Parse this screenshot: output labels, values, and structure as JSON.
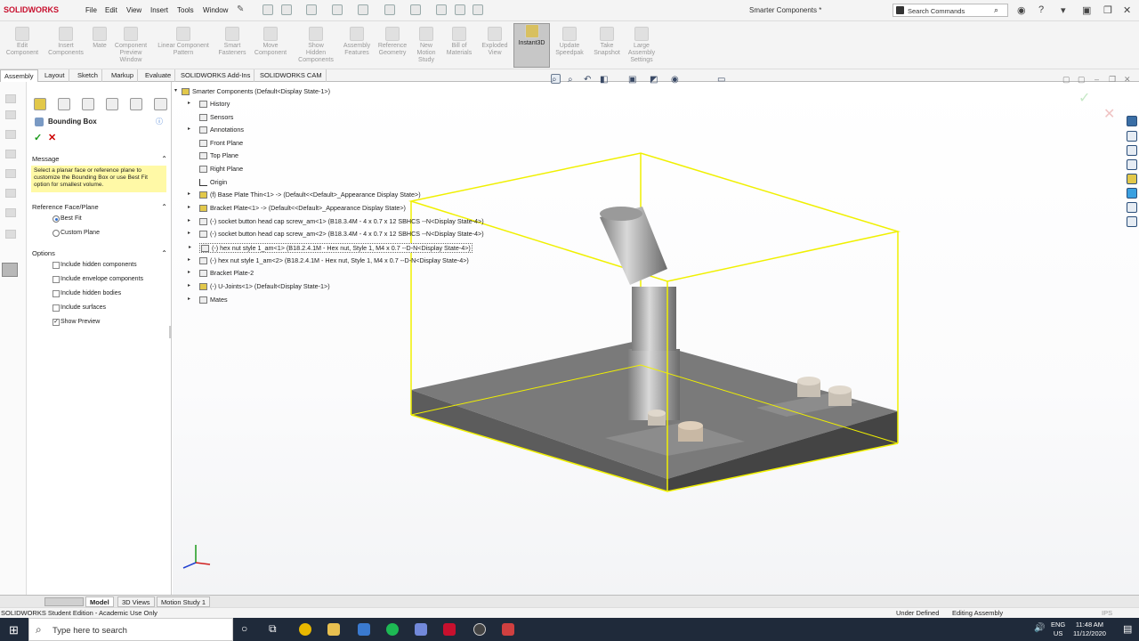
{
  "app": {
    "logo": "SOLIDWORKS",
    "window_title": "Smarter Components *"
  },
  "menu": [
    "File",
    "Edit",
    "View",
    "Insert",
    "Tools",
    "Window"
  ],
  "search": {
    "placeholder": "Search Commands"
  },
  "command_bar": [
    {
      "label": "Edit\nComponent"
    },
    {
      "label": "Insert\nComponents"
    },
    {
      "label": "Mate"
    },
    {
      "label": "Component\nPreview\nWindow"
    },
    {
      "label": "Linear Component\nPattern"
    },
    {
      "label": "Smart\nFasteners"
    },
    {
      "label": "Move\nComponent"
    },
    {
      "label": "Show\nHidden\nComponents"
    },
    {
      "label": "Assembly\nFeatures"
    },
    {
      "label": "Reference\nGeometry"
    },
    {
      "label": "New\nMotion\nStudy"
    },
    {
      "label": "Bill of\nMaterials"
    },
    {
      "label": "Exploded\nView"
    },
    {
      "label": "Instant3D"
    },
    {
      "label": "Update\nSpeedpak"
    },
    {
      "label": "Take\nSnapshot"
    },
    {
      "label": "Large\nAssembly\nSettings"
    }
  ],
  "tabs": [
    "Assembly",
    "Layout",
    "Sketch",
    "Markup",
    "Evaluate",
    "SOLIDWORKS Add-Ins",
    "SOLIDWORKS CAM"
  ],
  "property_manager": {
    "title": "Bounding Box",
    "message_header": "Message",
    "message": "Select a planar face or reference plane to customize the Bounding Box or use Best Fit option for smallest volume.",
    "reference_header": "Reference Face/Plane",
    "reference_options": [
      {
        "label": "Best Fit",
        "selected": true
      },
      {
        "label": "Custom Plane",
        "selected": false
      }
    ],
    "options_header": "Options",
    "options": [
      {
        "label": "Include hidden components",
        "checked": false
      },
      {
        "label": "Include envelope components",
        "checked": false
      },
      {
        "label": "Include hidden bodies",
        "checked": false
      },
      {
        "label": "Include surfaces",
        "checked": false
      },
      {
        "label": "Show Preview",
        "checked": true
      }
    ]
  },
  "tree": {
    "root": "Smarter Components  (Default<Display State-1>)",
    "items": [
      {
        "label": "History",
        "expand": true
      },
      {
        "label": "Sensors",
        "expand": false
      },
      {
        "label": "Annotations",
        "expand": true
      },
      {
        "label": "Front Plane",
        "expand": false
      },
      {
        "label": "Top Plane",
        "expand": false
      },
      {
        "label": "Right Plane",
        "expand": false
      },
      {
        "label": "Origin",
        "expand": false
      },
      {
        "label": "(f) Base Plate Thin<1> -> (Default<<Default>_Appearance Display State>)",
        "expand": true
      },
      {
        "label": "Bracket Plate<1> -> (Default<<Default>_Appearance Display State>)",
        "expand": true
      },
      {
        "label": "(-) socket button head cap screw_am<1> (B18.3.4M - 4 x 0.7 x 12 SBHCS --N<Display State-4>)",
        "expand": true
      },
      {
        "label": "(-) socket button head cap screw_am<2> (B18.3.4M - 4 x 0.7 x 12 SBHCS --N<Display State-4>)",
        "expand": true
      },
      {
        "label": "(-) hex nut style 1_am<1> (B18.2.4.1M - Hex nut, Style 1,  M4 x 0.7 --D-N<Display State-4>)",
        "expand": true
      },
      {
        "label": "(-) hex nut style 1_am<2> (B18.2.4.1M - Hex nut, Style 1,  M4 x 0.7 --D-N<Display State-4>)",
        "expand": true
      },
      {
        "label": "Bracket Plate-2",
        "expand": true
      },
      {
        "label": "(-) U-Joints<1> (Default<Display State-1>)",
        "expand": true
      },
      {
        "label": "Mates",
        "expand": true
      }
    ]
  },
  "bottom_tabs": [
    "Model",
    "3D Views",
    "Motion Study 1"
  ],
  "status": {
    "left": "SOLIDWORKS Student Edition - Academic Use Only",
    "state": "Under Defined",
    "mode": "Editing Assembly",
    "units": "IPS"
  },
  "taskbar": {
    "search_placeholder": "Type here to search",
    "lang": "ENG",
    "region": "US",
    "time": "11:48 AM",
    "date": "11/12/2020"
  },
  "colors": {
    "bounding_box": "#f0f000",
    "accent": "#c8102e"
  }
}
